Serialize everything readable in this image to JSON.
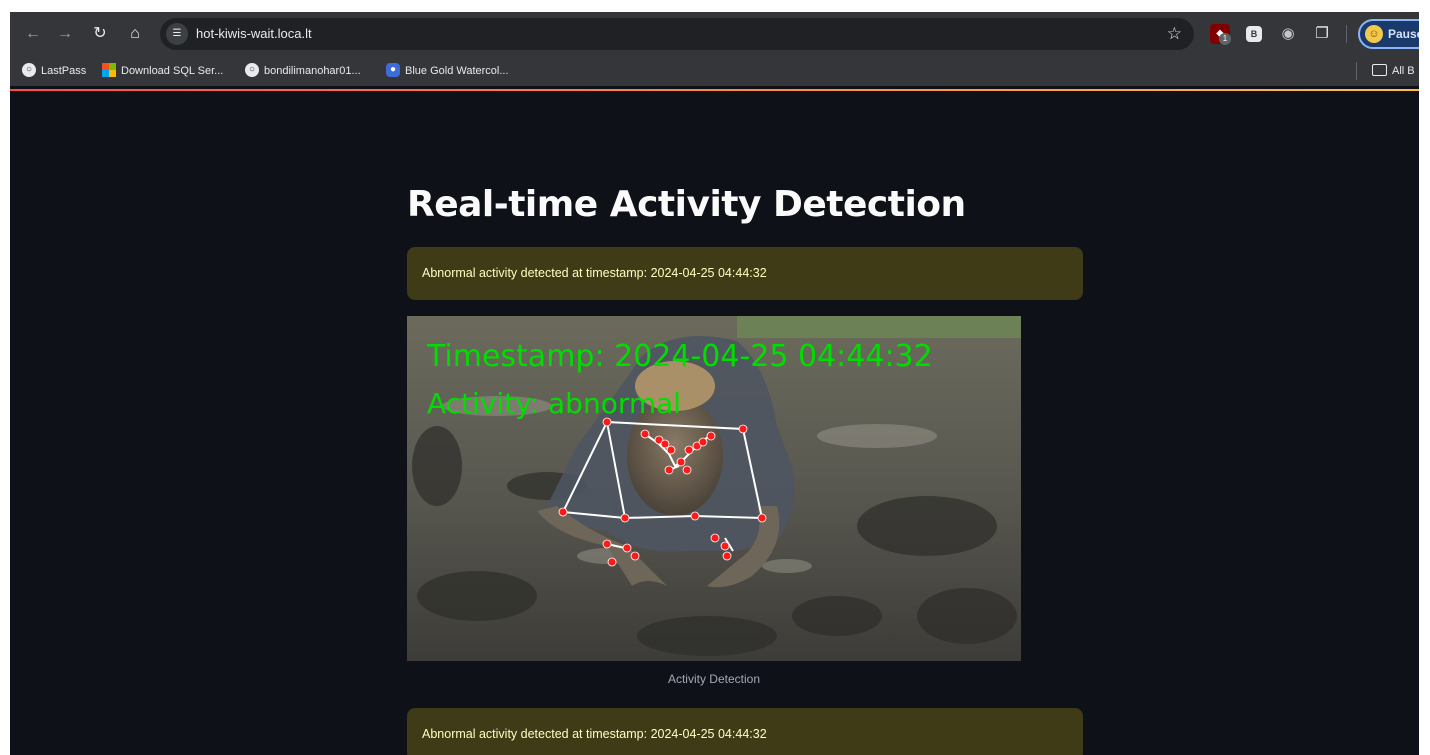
{
  "browser": {
    "url": "hot-kiwis-wait.loca.lt",
    "ublock_badge": "1",
    "ext_b_label": "B",
    "profile_label": "Pause"
  },
  "bookmarks": {
    "items": [
      {
        "label": "LastPass",
        "icon": "globe-icon"
      },
      {
        "label": "Download SQL Ser...",
        "icon": "microsoft-icon"
      },
      {
        "label": "bondilimanohar01...",
        "icon": "globe-icon"
      },
      {
        "label": "Blue Gold Watercol...",
        "icon": "palette-icon"
      }
    ],
    "all_label": "All B"
  },
  "app": {
    "title": "Real-time Activity Detection",
    "alerts": [
      "Abnormal activity detected at timestamp: 2024-04-25 04:44:32",
      "Abnormal activity detected at timestamp: 2024-04-25 04:44:32"
    ],
    "frame": {
      "overlay_timestamp": "Timestamp: 2024-04-25 04:44:32",
      "overlay_activity": "Activity: abnormal",
      "overlay_color": "#00dd00"
    },
    "caption": "Activity Detection"
  },
  "colors": {
    "app_background": "#0e1117",
    "alert_background": "#3e3b16",
    "alert_text": "#ffffc2",
    "landmark_dot": "#ff1a1a"
  }
}
